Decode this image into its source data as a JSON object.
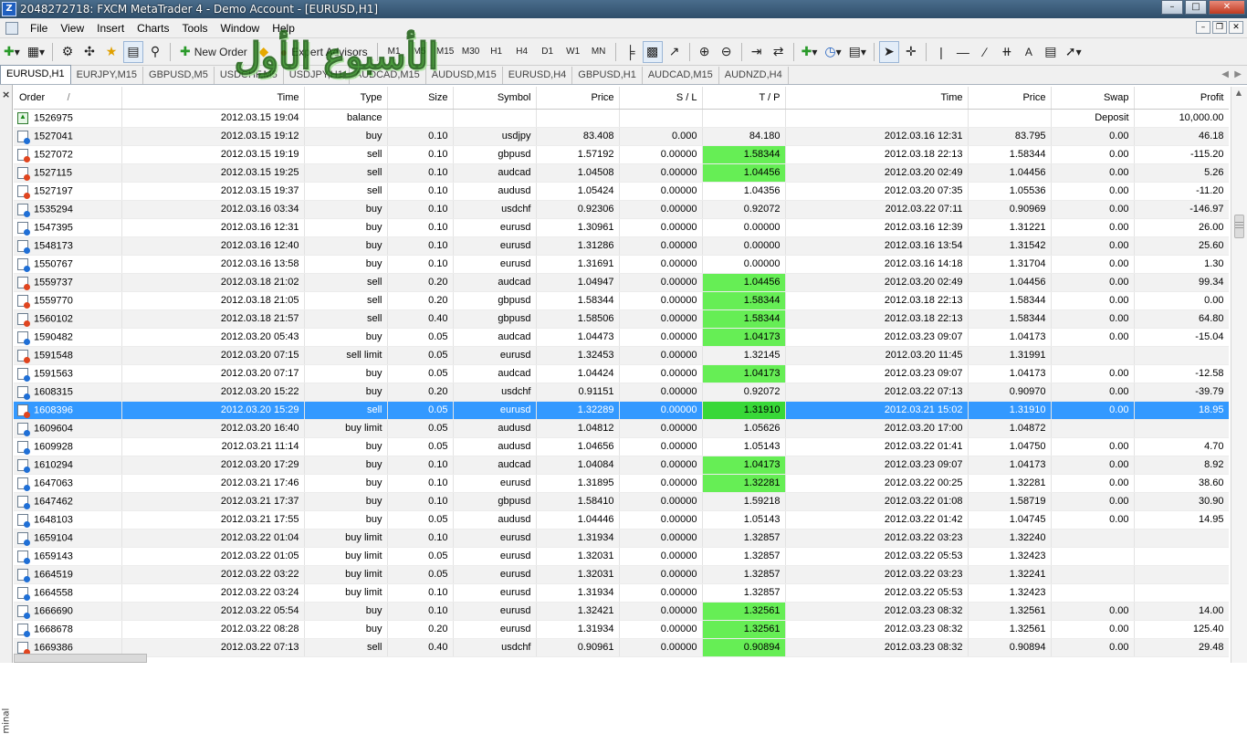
{
  "window": {
    "title": "2048272718: FXCM MetaTrader 4 - Demo Account - [EURUSD,H1]",
    "app_icon": "Z"
  },
  "menu": [
    "File",
    "View",
    "Insert",
    "Charts",
    "Tools",
    "Window",
    "Help"
  ],
  "toolbar": {
    "new_order": "New Order",
    "expert_advisors": "Expert Advisors",
    "timeframes": [
      "M1",
      "M5",
      "M15",
      "M30",
      "H1",
      "H4",
      "D1",
      "W1",
      "MN"
    ],
    "font_letter": "A"
  },
  "overlay_text": "الأسبوع الأول",
  "chart_tabs": [
    "EURUSD,H1",
    "EURJPY,M15",
    "GBPUSD,M5",
    "USDCHF,M5",
    "USDJPY,H1",
    "AUDCAD,M15",
    "AUDUSD,M15",
    "EURUSD,H4",
    "GBPUSD,H1",
    "AUDCAD,M15",
    "AUDNZD,H4"
  ],
  "sidebar": {
    "close": "×",
    "label": "minal"
  },
  "columns": [
    "Order",
    "/",
    "Time",
    "Type",
    "Size",
    "Symbol",
    "Price",
    "S / L",
    "T / P",
    "Time",
    "Price",
    "Swap",
    "Profit"
  ],
  "rows": [
    {
      "icon": "balance",
      "order": "1526975",
      "time": "2012.03.15 19:04",
      "type": "balance",
      "size": "",
      "symbol": "",
      "price": "",
      "sl": "",
      "tp": "",
      "ctime": "",
      "cprice": "",
      "swap": "Deposit",
      "profit": "10,000.00",
      "hl": false
    },
    {
      "icon": "buy",
      "order": "1527041",
      "time": "2012.03.15 19:12",
      "type": "buy",
      "size": "0.10",
      "symbol": "usdjpy",
      "price": "83.408",
      "sl": "0.000",
      "tp": "84.180",
      "ctime": "2012.03.16 12:31",
      "cprice": "83.795",
      "swap": "0.00",
      "profit": "46.18",
      "hl": false
    },
    {
      "icon": "sell",
      "order": "1527072",
      "time": "2012.03.15 19:19",
      "type": "sell",
      "size": "0.10",
      "symbol": "gbpusd",
      "price": "1.57192",
      "sl": "0.00000",
      "tp": "1.58344",
      "ctime": "2012.03.18 22:13",
      "cprice": "1.58344",
      "swap": "0.00",
      "profit": "-115.20",
      "hl": true
    },
    {
      "icon": "sell",
      "order": "1527115",
      "time": "2012.03.15 19:25",
      "type": "sell",
      "size": "0.10",
      "symbol": "audcad",
      "price": "1.04508",
      "sl": "0.00000",
      "tp": "1.04456",
      "ctime": "2012.03.20 02:49",
      "cprice": "1.04456",
      "swap": "0.00",
      "profit": "5.26",
      "hl": true
    },
    {
      "icon": "sell",
      "order": "1527197",
      "time": "2012.03.15 19:37",
      "type": "sell",
      "size": "0.10",
      "symbol": "audusd",
      "price": "1.05424",
      "sl": "0.00000",
      "tp": "1.04356",
      "ctime": "2012.03.20 07:35",
      "cprice": "1.05536",
      "swap": "0.00",
      "profit": "-11.20",
      "hl": false
    },
    {
      "icon": "buy",
      "order": "1535294",
      "time": "2012.03.16 03:34",
      "type": "buy",
      "size": "0.10",
      "symbol": "usdchf",
      "price": "0.92306",
      "sl": "0.00000",
      "tp": "0.92072",
      "ctime": "2012.03.22 07:11",
      "cprice": "0.90969",
      "swap": "0.00",
      "profit": "-146.97",
      "hl": false
    },
    {
      "icon": "buy",
      "order": "1547395",
      "time": "2012.03.16 12:31",
      "type": "buy",
      "size": "0.10",
      "symbol": "eurusd",
      "price": "1.30961",
      "sl": "0.00000",
      "tp": "0.00000",
      "ctime": "2012.03.16 12:39",
      "cprice": "1.31221",
      "swap": "0.00",
      "profit": "26.00",
      "hl": false
    },
    {
      "icon": "buy",
      "order": "1548173",
      "time": "2012.03.16 12:40",
      "type": "buy",
      "size": "0.10",
      "symbol": "eurusd",
      "price": "1.31286",
      "sl": "0.00000",
      "tp": "0.00000",
      "ctime": "2012.03.16 13:54",
      "cprice": "1.31542",
      "swap": "0.00",
      "profit": "25.60",
      "hl": false
    },
    {
      "icon": "buy",
      "order": "1550767",
      "time": "2012.03.16 13:58",
      "type": "buy",
      "size": "0.10",
      "symbol": "eurusd",
      "price": "1.31691",
      "sl": "0.00000",
      "tp": "0.00000",
      "ctime": "2012.03.16 14:18",
      "cprice": "1.31704",
      "swap": "0.00",
      "profit": "1.30",
      "hl": false
    },
    {
      "icon": "sell",
      "order": "1559737",
      "time": "2012.03.18 21:02",
      "type": "sell",
      "size": "0.20",
      "symbol": "audcad",
      "price": "1.04947",
      "sl": "0.00000",
      "tp": "1.04456",
      "ctime": "2012.03.20 02:49",
      "cprice": "1.04456",
      "swap": "0.00",
      "profit": "99.34",
      "hl": true
    },
    {
      "icon": "sell",
      "order": "1559770",
      "time": "2012.03.18 21:05",
      "type": "sell",
      "size": "0.20",
      "symbol": "gbpusd",
      "price": "1.58344",
      "sl": "0.00000",
      "tp": "1.58344",
      "ctime": "2012.03.18 22:13",
      "cprice": "1.58344",
      "swap": "0.00",
      "profit": "0.00",
      "hl": true
    },
    {
      "icon": "sell",
      "order": "1560102",
      "time": "2012.03.18 21:57",
      "type": "sell",
      "size": "0.40",
      "symbol": "gbpusd",
      "price": "1.58506",
      "sl": "0.00000",
      "tp": "1.58344",
      "ctime": "2012.03.18 22:13",
      "cprice": "1.58344",
      "swap": "0.00",
      "profit": "64.80",
      "hl": true
    },
    {
      "icon": "buy",
      "order": "1590482",
      "time": "2012.03.20 05:43",
      "type": "buy",
      "size": "0.05",
      "symbol": "audcad",
      "price": "1.04473",
      "sl": "0.00000",
      "tp": "1.04173",
      "ctime": "2012.03.23 09:07",
      "cprice": "1.04173",
      "swap": "0.00",
      "profit": "-15.04",
      "hl": true
    },
    {
      "icon": "sell",
      "order": "1591548",
      "time": "2012.03.20 07:15",
      "type": "sell limit",
      "size": "0.05",
      "symbol": "eurusd",
      "price": "1.32453",
      "sl": "0.00000",
      "tp": "1.32145",
      "ctime": "2012.03.20 11:45",
      "cprice": "1.31991",
      "swap": "",
      "profit": "",
      "hl": false
    },
    {
      "icon": "buy",
      "order": "1591563",
      "time": "2012.03.20 07:17",
      "type": "buy",
      "size": "0.05",
      "symbol": "audcad",
      "price": "1.04424",
      "sl": "0.00000",
      "tp": "1.04173",
      "ctime": "2012.03.23 09:07",
      "cprice": "1.04173",
      "swap": "0.00",
      "profit": "-12.58",
      "hl": true
    },
    {
      "icon": "buy",
      "order": "1608315",
      "time": "2012.03.20 15:22",
      "type": "buy",
      "size": "0.20",
      "symbol": "usdchf",
      "price": "0.91151",
      "sl": "0.00000",
      "tp": "0.92072",
      "ctime": "2012.03.22 07:13",
      "cprice": "0.90970",
      "swap": "0.00",
      "profit": "-39.79",
      "hl": false
    },
    {
      "icon": "sell",
      "order": "1608396",
      "time": "2012.03.20 15:29",
      "type": "sell",
      "size": "0.05",
      "symbol": "eurusd",
      "price": "1.32289",
      "sl": "0.00000",
      "tp": "1.31910",
      "ctime": "2012.03.21 15:02",
      "cprice": "1.31910",
      "swap": "0.00",
      "profit": "18.95",
      "hl": true,
      "selected": true
    },
    {
      "icon": "buy",
      "order": "1609604",
      "time": "2012.03.20 16:40",
      "type": "buy limit",
      "size": "0.05",
      "symbol": "audusd",
      "price": "1.04812",
      "sl": "0.00000",
      "tp": "1.05626",
      "ctime": "2012.03.20 17:00",
      "cprice": "1.04872",
      "swap": "",
      "profit": "",
      "hl": false
    },
    {
      "icon": "buy",
      "order": "1609928",
      "time": "2012.03.21 11:14",
      "type": "buy",
      "size": "0.05",
      "symbol": "audusd",
      "price": "1.04656",
      "sl": "0.00000",
      "tp": "1.05143",
      "ctime": "2012.03.22 01:41",
      "cprice": "1.04750",
      "swap": "0.00",
      "profit": "4.70",
      "hl": false
    },
    {
      "icon": "buy",
      "order": "1610294",
      "time": "2012.03.20 17:29",
      "type": "buy",
      "size": "0.10",
      "symbol": "audcad",
      "price": "1.04084",
      "sl": "0.00000",
      "tp": "1.04173",
      "ctime": "2012.03.23 09:07",
      "cprice": "1.04173",
      "swap": "0.00",
      "profit": "8.92",
      "hl": true
    },
    {
      "icon": "buy",
      "order": "1647063",
      "time": "2012.03.21 17:46",
      "type": "buy",
      "size": "0.10",
      "symbol": "eurusd",
      "price": "1.31895",
      "sl": "0.00000",
      "tp": "1.32281",
      "ctime": "2012.03.22 00:25",
      "cprice": "1.32281",
      "swap": "0.00",
      "profit": "38.60",
      "hl": true
    },
    {
      "icon": "buy",
      "order": "1647462",
      "time": "2012.03.21 17:37",
      "type": "buy",
      "size": "0.10",
      "symbol": "gbpusd",
      "price": "1.58410",
      "sl": "0.00000",
      "tp": "1.59218",
      "ctime": "2012.03.22 01:08",
      "cprice": "1.58719",
      "swap": "0.00",
      "profit": "30.90",
      "hl": false
    },
    {
      "icon": "buy",
      "order": "1648103",
      "time": "2012.03.21 17:55",
      "type": "buy",
      "size": "0.05",
      "symbol": "audusd",
      "price": "1.04446",
      "sl": "0.00000",
      "tp": "1.05143",
      "ctime": "2012.03.22 01:42",
      "cprice": "1.04745",
      "swap": "0.00",
      "profit": "14.95",
      "hl": false
    },
    {
      "icon": "buy",
      "order": "1659104",
      "time": "2012.03.22 01:04",
      "type": "buy limit",
      "size": "0.10",
      "symbol": "eurusd",
      "price": "1.31934",
      "sl": "0.00000",
      "tp": "1.32857",
      "ctime": "2012.03.22 03:23",
      "cprice": "1.32240",
      "swap": "",
      "profit": "",
      "hl": false
    },
    {
      "icon": "buy",
      "order": "1659143",
      "time": "2012.03.22 01:05",
      "type": "buy limit",
      "size": "0.05",
      "symbol": "eurusd",
      "price": "1.32031",
      "sl": "0.00000",
      "tp": "1.32857",
      "ctime": "2012.03.22 05:53",
      "cprice": "1.32423",
      "swap": "",
      "profit": "",
      "hl": false
    },
    {
      "icon": "buy",
      "order": "1664519",
      "time": "2012.03.22 03:22",
      "type": "buy limit",
      "size": "0.05",
      "symbol": "eurusd",
      "price": "1.32031",
      "sl": "0.00000",
      "tp": "1.32857",
      "ctime": "2012.03.22 03:23",
      "cprice": "1.32241",
      "swap": "",
      "profit": "",
      "hl": false
    },
    {
      "icon": "buy",
      "order": "1664558",
      "time": "2012.03.22 03:24",
      "type": "buy limit",
      "size": "0.10",
      "symbol": "eurusd",
      "price": "1.31934",
      "sl": "0.00000",
      "tp": "1.32857",
      "ctime": "2012.03.22 05:53",
      "cprice": "1.32423",
      "swap": "",
      "profit": "",
      "hl": false
    },
    {
      "icon": "buy",
      "order": "1666690",
      "time": "2012.03.22 05:54",
      "type": "buy",
      "size": "0.10",
      "symbol": "eurusd",
      "price": "1.32421",
      "sl": "0.00000",
      "tp": "1.32561",
      "ctime": "2012.03.23 08:32",
      "cprice": "1.32561",
      "swap": "0.00",
      "profit": "14.00",
      "hl": true
    },
    {
      "icon": "buy",
      "order": "1668678",
      "time": "2012.03.22 08:28",
      "type": "buy",
      "size": "0.20",
      "symbol": "eurusd",
      "price": "1.31934",
      "sl": "0.00000",
      "tp": "1.32561",
      "ctime": "2012.03.23 08:32",
      "cprice": "1.32561",
      "swap": "0.00",
      "profit": "125.40",
      "hl": true
    },
    {
      "icon": "sell",
      "order": "1669386",
      "time": "2012.03.22 07:13",
      "type": "sell",
      "size": "0.40",
      "symbol": "usdchf",
      "price": "0.90961",
      "sl": "0.00000",
      "tp": "0.90894",
      "ctime": "2012.03.23 08:32",
      "cprice": "0.90894",
      "swap": "0.00",
      "profit": "29.48",
      "hl": true
    }
  ],
  "colors": {
    "tp_hit": "#66ee55",
    "selected_row": "#3399ff",
    "title_bar": "#3a5c7a"
  }
}
